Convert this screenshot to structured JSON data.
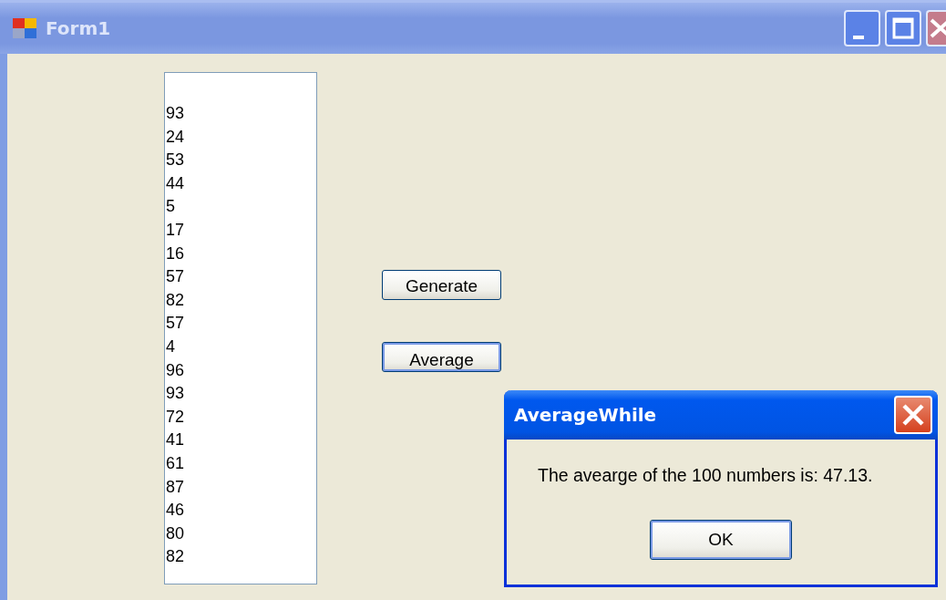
{
  "window": {
    "title": "Form1"
  },
  "list_box": {
    "items": [
      "93",
      "24",
      "53",
      "44",
      "5",
      "17",
      "16",
      "57",
      "82",
      "57",
      "4",
      "96",
      "93",
      "72",
      "41",
      "61",
      "87",
      "46",
      "80",
      "82"
    ]
  },
  "buttons": [
    {
      "label": "Generate",
      "focused": false
    },
    {
      "label": "Average",
      "focused": true
    }
  ],
  "dialog": {
    "title": "AverageWhile",
    "message": "The avearge of the 100 numbers is: 47.13.",
    "button": "OK"
  }
}
